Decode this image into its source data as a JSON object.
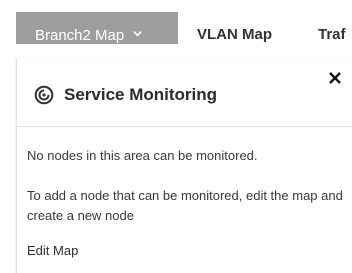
{
  "tabs": [
    {
      "label": "Branch2 Map"
    },
    {
      "label": "VLAN Map"
    },
    {
      "label": "Traf"
    }
  ],
  "panel": {
    "title": "Service Monitoring",
    "icon": "gauge-icon",
    "message_1": "No nodes in this area can be monitored.",
    "message_2": "To add a node that can be monitored, edit the map and create a new node",
    "edit_link": "Edit Map"
  }
}
